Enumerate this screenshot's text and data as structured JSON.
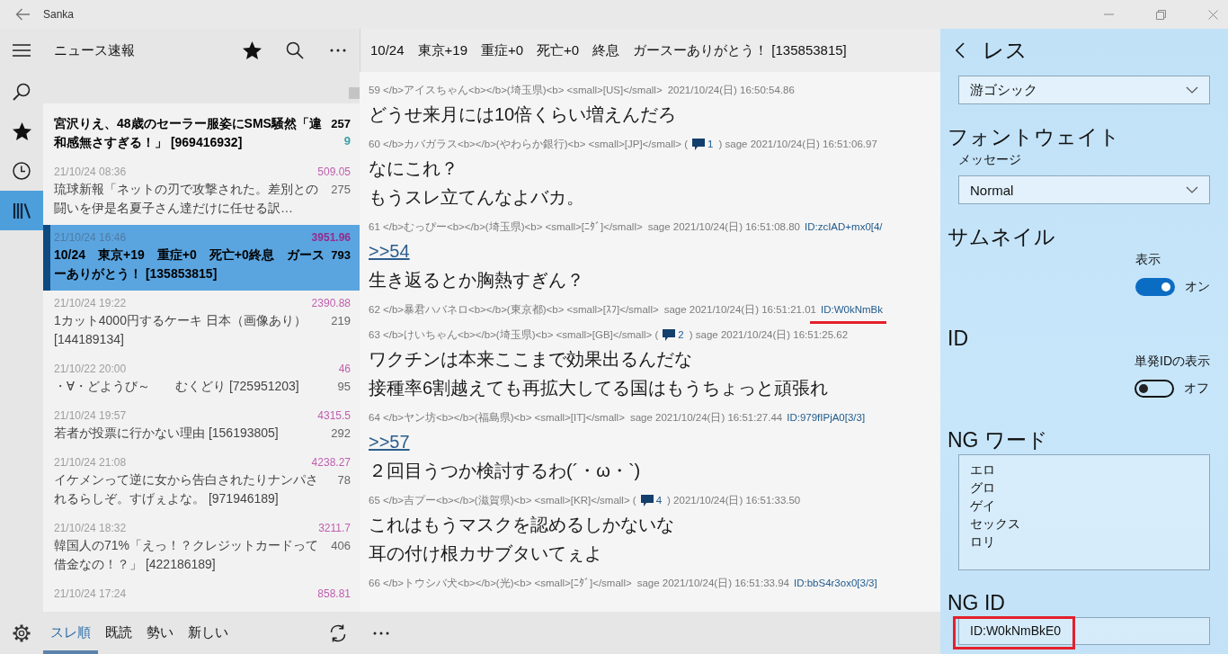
{
  "window": {
    "title": "Sanka"
  },
  "nav": [
    {
      "kind": "search",
      "selected": false
    },
    {
      "kind": "star",
      "selected": false
    },
    {
      "kind": "clock",
      "selected": false
    },
    {
      "kind": "library",
      "selected": true
    }
  ],
  "board": {
    "title": "ニュース速報"
  },
  "threads": [
    {
      "title": "宮沢りえ、48歳のセーラー服姿にSMS騒然「違和感無さすぎる！」 [969416932]",
      "count": "257",
      "new_count": "9",
      "bold": true,
      "selected": false
    },
    {
      "date": "21/10/24 08:36",
      "score": "509.05",
      "title": "琉球新報「ネットの刃で攻撃された。差別との闘いを伊是名夏子さん達だけに任せる訳…",
      "count": "275",
      "bold": false,
      "selected": false
    },
    {
      "date": "21/10/24 16:46",
      "score": "3951.96",
      "title": "10/24　東京+19　重症+0　死亡+0終息　ガースーありがとう！ [135853815]",
      "count": "793",
      "bold": true,
      "selected": true
    },
    {
      "date": "21/10/24 19:22",
      "score": "2390.88",
      "title": "1カット4000円するケーキ 日本（画像あり） [144189134]",
      "count": "219",
      "bold": false,
      "selected": false
    },
    {
      "date": "21/10/22 20:00",
      "score": "46",
      "title": "・∀・どようび～　　むくどり [725951203]",
      "count": "95",
      "bold": false,
      "selected": false
    },
    {
      "date": "21/10/24 19:57",
      "score": "4315.5",
      "title": "若者が投票に行かない理由 [156193805]",
      "count": "292",
      "bold": false,
      "selected": false
    },
    {
      "date": "21/10/24 21:08",
      "score": "4238.27",
      "title": "イケメンって逆に女から告白されたりナンパされるらしぞ。すげぇよな。 [971946189]",
      "count": "78",
      "bold": false,
      "selected": false
    },
    {
      "date": "21/10/24 18:32",
      "score": "3211.7",
      "title": "韓国人の71%「えっ！？クレジットカードって借金なの！？」 [422186189]",
      "count": "406",
      "bold": false,
      "selected": false
    },
    {
      "date": "21/10/24 17:24",
      "score": "858.81",
      "bold": false,
      "selected": false
    }
  ],
  "sort_tabs": [
    {
      "label": "スレ順",
      "selected": true
    },
    {
      "label": "既読",
      "selected": false
    },
    {
      "label": "勢い",
      "selected": false
    },
    {
      "label": "新しい",
      "selected": false
    }
  ],
  "thread_view": {
    "title": "10/24　東京+19　重症+0　死亡+0　終息　ガースーありがとう！ [135853815]",
    "posts": [
      {
        "header": "59 </b>アイスちゃん<b></b>(埼玉県)<b> <small>[US]</small>",
        "date": "2021/10/24(日) 16:50:54.86",
        "lines": [
          "どうせ来月には10倍くらい増えんだろ"
        ]
      },
      {
        "header": "60 </b>カバガラス<b></b>(やわらか銀行)<b> <small>[JP]</small> (",
        "replies": "1",
        "date": ") sage 2021/10/24(日) 16:51:06.97",
        "lines": [
          "なにこれ？",
          "もうスレ立てんなよバカ。"
        ]
      },
      {
        "header": "61 </b>むっぴー<b></b>(埼玉県)<b> <small>[ﾆﾀﾞ]</small>",
        "date": "sage 2021/10/24(日) 16:51:08.80",
        "id": "ID:zcIAD+mx0[4/",
        "id_highlighted": false,
        "anchor": ">>54",
        "lines": [
          "生き返るとか胸熱すぎん？"
        ]
      },
      {
        "header": "62 </b>暴君ハバネロ<b></b>(東京都)<b> <small>[ｽﾌ]</small>",
        "date": "sage 2021/10/24(日) 16:51:21.01",
        "id": "ID:W0kNmBk",
        "id_highlighted": true
      },
      {
        "header": "63 </b>けいちゃん<b></b>(埼玉県)<b> <small>[GB]</small> (",
        "replies": "2",
        "date": ") sage 2021/10/24(日) 16:51:25.62",
        "lines": [
          "ワクチンは本来ここまで効果出るんだな",
          "接種率6割越えても再拡大してる国はもうちょっと頑張れ"
        ]
      },
      {
        "header": "64 </b>ヤン坊<b></b>(福島県)<b> <small>[IT]</small>",
        "date": "sage 2021/10/24(日) 16:51:27.44",
        "id": "ID:979fIPjA0[3/3]",
        "id_highlighted": false,
        "anchor": ">>57",
        "lines": [
          "２回目うつか検討するわ(´・ω・`)"
        ]
      },
      {
        "header": "65 </b>吉プー<b></b>(滋賀県)<b> <small>[KR]</small> (",
        "replies": "4",
        "date": ") 2021/10/24(日) 16:51:33.50",
        "lines": [
          "これはもうマスクを認めるしかないな",
          "耳の付け根カサブタいてぇよ"
        ]
      },
      {
        "header": "66 </b>トウシバ犬<b></b>(光)<b> <small>[ﾆﾀﾞ]</small>",
        "date": "sage 2021/10/24(日) 16:51:33.94",
        "id": "ID:bbS4r3ox0[3/3]",
        "id_highlighted": false
      }
    ]
  },
  "settings": {
    "title": "レス",
    "blocks": [
      {
        "kind": "dropdown",
        "value": "游ゴシック"
      },
      {
        "kind": "heading",
        "text": "フォントウェイト"
      },
      {
        "kind": "caption",
        "text": "メッセージ"
      },
      {
        "kind": "dropdown",
        "value": "Normal"
      },
      {
        "kind": "heading",
        "text": "サムネイル"
      },
      {
        "kind": "toggle",
        "label": "表示",
        "on": true,
        "state_label": "オン"
      },
      {
        "kind": "heading",
        "text": "ID"
      },
      {
        "kind": "toggle",
        "label": "単発IDの表示",
        "on": false,
        "state_label": "オフ"
      },
      {
        "kind": "heading",
        "text": "NG ワード"
      },
      {
        "kind": "textarea",
        "lines": [
          "エロ",
          "グロ",
          "ゲイ",
          "セックス",
          "ロリ"
        ]
      },
      {
        "kind": "heading",
        "text": "NG ID"
      },
      {
        "kind": "input",
        "value": "ID:W0kNmBkE0",
        "highlighted": true
      }
    ]
  }
}
